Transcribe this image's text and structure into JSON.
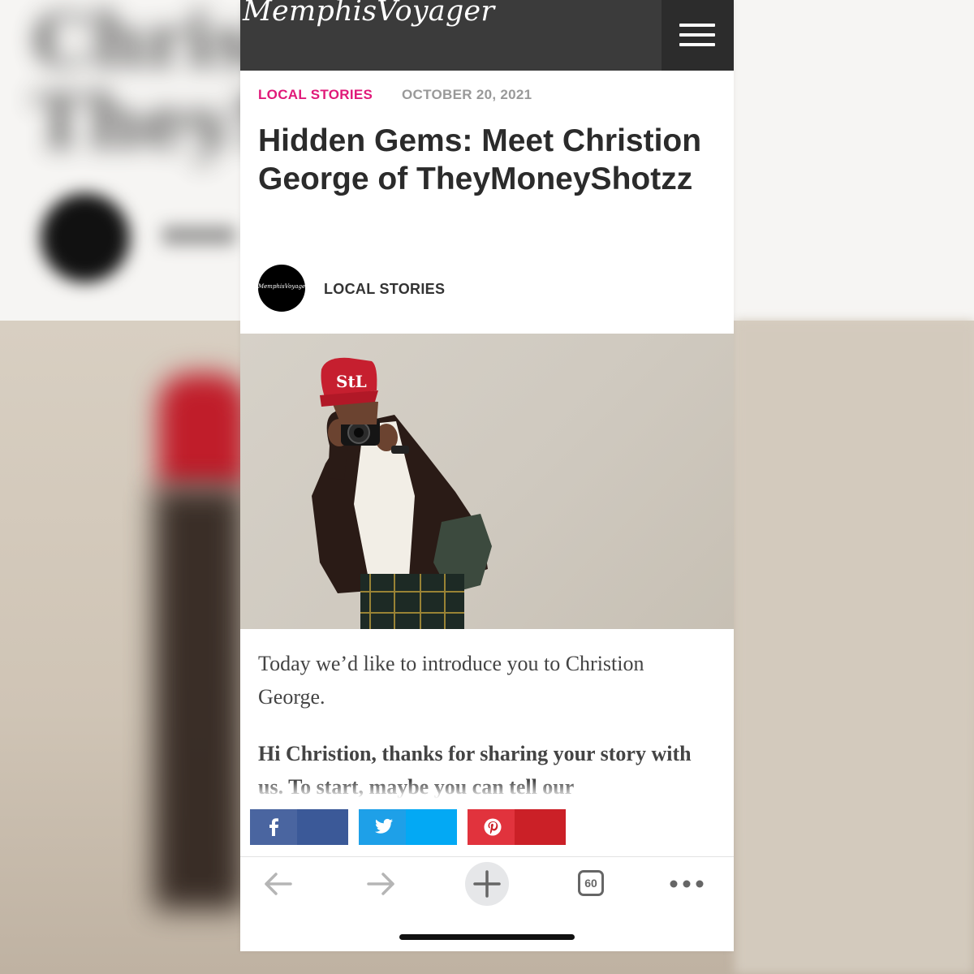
{
  "site": {
    "logo": "MemphisVoyager"
  },
  "article": {
    "category": "LOCAL STORIES",
    "date": "OCTOBER 20, 2021",
    "title": "Hidden Gems: Meet Christion George of TheyMoneyShotzz",
    "author_avatar_text": "MemphisVoyager",
    "author": "LOCAL STORIES",
    "intro": "Today we’d like to introduce you to Christion George.",
    "question": "Hi Christion, thanks for sharing your story with us. To start, maybe you can tell our"
  },
  "share": [
    {
      "name": "facebook",
      "icon": "facebook-icon",
      "color": "#3b5998"
    },
    {
      "name": "twitter",
      "icon": "twitter-icon",
      "color": "#03a9f4"
    },
    {
      "name": "pinterest",
      "icon": "pinterest-icon",
      "color": "#cb2027"
    }
  ],
  "browser": {
    "tab_count": "60",
    "icons": [
      "back-arrow-icon",
      "forward-arrow-icon",
      "new-tab-plus-icon",
      "tabs-icon",
      "more-icon"
    ]
  },
  "colors": {
    "accent": "#e01979",
    "header": "#3b3b3b",
    "headline": "#2b2b2b"
  }
}
